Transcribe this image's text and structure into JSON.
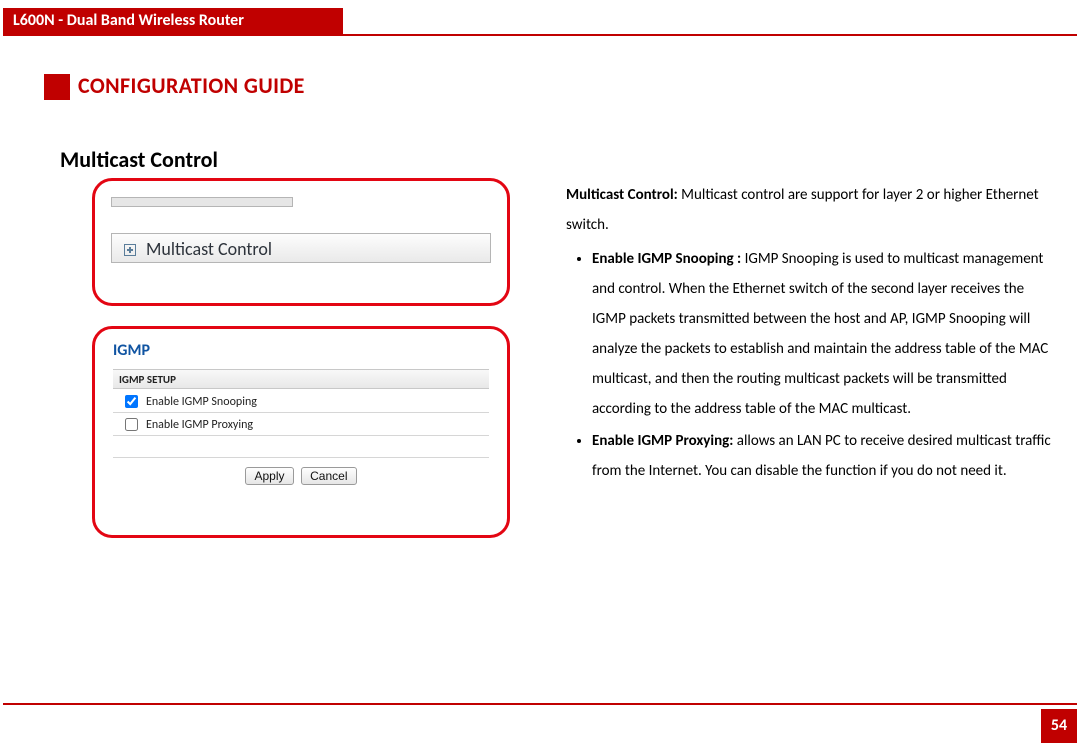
{
  "header": {
    "product_title": "L600N - Dual Band Wireless Router",
    "doc_title": "CONFIGURATION GUIDE",
    "section_title": "Multicast Control"
  },
  "callout1": {
    "nav_item_label": "Multicast Control"
  },
  "callout2": {
    "igmp_title": "IGMP",
    "setup_label": "IGMP SETUP",
    "option1": {
      "label": "Enable IGMP Snooping",
      "checked": true
    },
    "option2": {
      "label": "Enable IGMP Proxying",
      "checked": false
    },
    "apply_label": "Apply",
    "cancel_label": "Cancel"
  },
  "description": {
    "lead_strong": "Multicast Control:",
    "lead_text": " Multicast control are support for layer 2 or higher Ethernet switch.",
    "items": [
      {
        "strong": "Enable IGMP Snooping :",
        "text": " IGMP Snooping is used to multicast management and control. When the Ethernet switch of the second layer receives the IGMP packets transmitted between the host and AP, IGMP Snooping will analyze the packets to establish and maintain the address table of the MAC multicast, and then the routing multicast packets will be transmitted according to the address table of the MAC multicast."
      },
      {
        "strong": "Enable IGMP Proxying:",
        "text": " allows an LAN PC to receive desired multicast traffic from the Internet. You can disable the function if you do not need it."
      }
    ]
  },
  "page_number": "54"
}
